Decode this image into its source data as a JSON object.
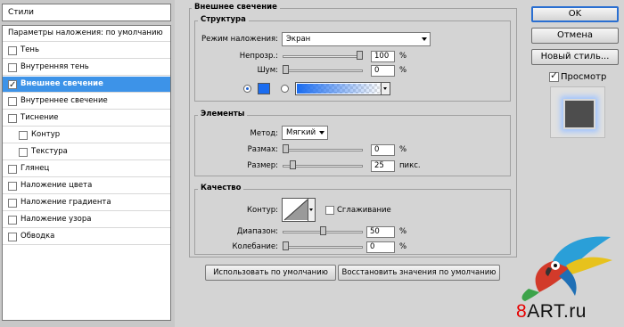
{
  "styles_panel": {
    "title": "Стили",
    "blend_defaults": "Параметры наложения: по умолчанию",
    "items": [
      {
        "label": "Тень",
        "checked": false
      },
      {
        "label": "Внутренняя тень",
        "checked": false
      },
      {
        "label": "Внешнее свечение",
        "checked": true
      },
      {
        "label": "Внутреннее свечение",
        "checked": false
      },
      {
        "label": "Тиснение",
        "checked": false
      },
      {
        "label": "Контур",
        "checked": false
      },
      {
        "label": "Текстура",
        "checked": false
      },
      {
        "label": "Глянец",
        "checked": false
      },
      {
        "label": "Наложение цвета",
        "checked": false
      },
      {
        "label": "Наложение градиента",
        "checked": false
      },
      {
        "label": "Наложение узора",
        "checked": false
      },
      {
        "label": "Обводка",
        "checked": false
      }
    ]
  },
  "dialog": {
    "title": "Внешнее свечение",
    "structure": {
      "title": "Структура",
      "blend_mode_label": "Режим наложения:",
      "blend_mode_value": "Экран",
      "opacity_label": "Непрозр.:",
      "opacity_value": "100",
      "opacity_unit": "%",
      "opacity_level": 1.0,
      "noise_label": "Шум:",
      "noise_value": "0",
      "noise_unit": "%",
      "noise_level": 0.0,
      "glow_color": "#1a6cf0"
    },
    "elements": {
      "title": "Элементы",
      "technique_label": "Метод:",
      "technique_value": "Мягкий",
      "spread_label": "Размах:",
      "spread_value": "0",
      "spread_unit": "%",
      "spread_level": 0.0,
      "size_label": "Размер:",
      "size_value": "25",
      "size_unit": "пикс.",
      "size_level": 0.1
    },
    "quality": {
      "title": "Качество",
      "contour_label": "Контур:",
      "antialias_label": "Сглаживание",
      "antialias_checked": false,
      "range_label": "Диапазон:",
      "range_value": "50",
      "range_unit": "%",
      "range_level": 0.5,
      "jitter_label": "Колебание:",
      "jitter_value": "0",
      "jitter_unit": "%",
      "jitter_level": 0.0
    },
    "make_default_label": "Использовать по умолчанию",
    "reset_default_label": "Восстановить значения по умолчанию"
  },
  "actions": {
    "ok_label": "OK",
    "cancel_label": "Отмена",
    "new_style_label": "Новый стиль...",
    "preview_label": "Просмотр",
    "preview_checked": true
  },
  "watermark": {
    "text": "8ART.ru",
    "accent": "#e60000"
  }
}
